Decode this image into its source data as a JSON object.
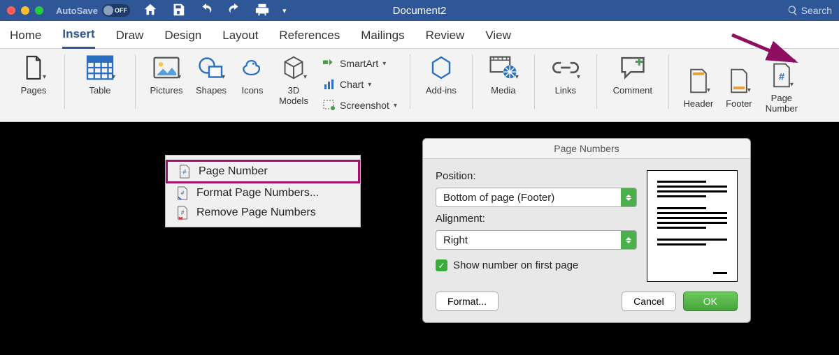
{
  "title": "Document2",
  "autosave": {
    "label": "AutoSave",
    "state": "OFF"
  },
  "search_placeholder": "Search",
  "tabs": [
    "Home",
    "Insert",
    "Draw",
    "Design",
    "Layout",
    "References",
    "Mailings",
    "Review",
    "View"
  ],
  "active_tab": "Insert",
  "ribbon": {
    "pages": {
      "label": "Pages"
    },
    "table": {
      "label": "Table"
    },
    "pictures": {
      "label": "Pictures"
    },
    "shapes": {
      "label": "Shapes"
    },
    "icons": {
      "label": "Icons"
    },
    "models": {
      "label": "3D\nModels"
    },
    "smartart": {
      "label": "SmartArt"
    },
    "chart": {
      "label": "Chart"
    },
    "screenshot": {
      "label": "Screenshot"
    },
    "addins": {
      "label": "Add-ins"
    },
    "media": {
      "label": "Media"
    },
    "links": {
      "label": "Links"
    },
    "comment": {
      "label": "Comment"
    },
    "header": {
      "label": "Header"
    },
    "footer": {
      "label": "Footer"
    },
    "pagenum": {
      "label": "Page\nNumber"
    }
  },
  "dropdown": {
    "page_number": "Page Number",
    "format": "Format Page Numbers...",
    "remove": "Remove Page Numbers"
  },
  "dialog": {
    "title": "Page Numbers",
    "position_label": "Position:",
    "position_value": "Bottom of page (Footer)",
    "alignment_label": "Alignment:",
    "alignment_value": "Right",
    "show_first": "Show number on first page",
    "format_btn": "Format...",
    "cancel": "Cancel",
    "ok": "OK"
  }
}
